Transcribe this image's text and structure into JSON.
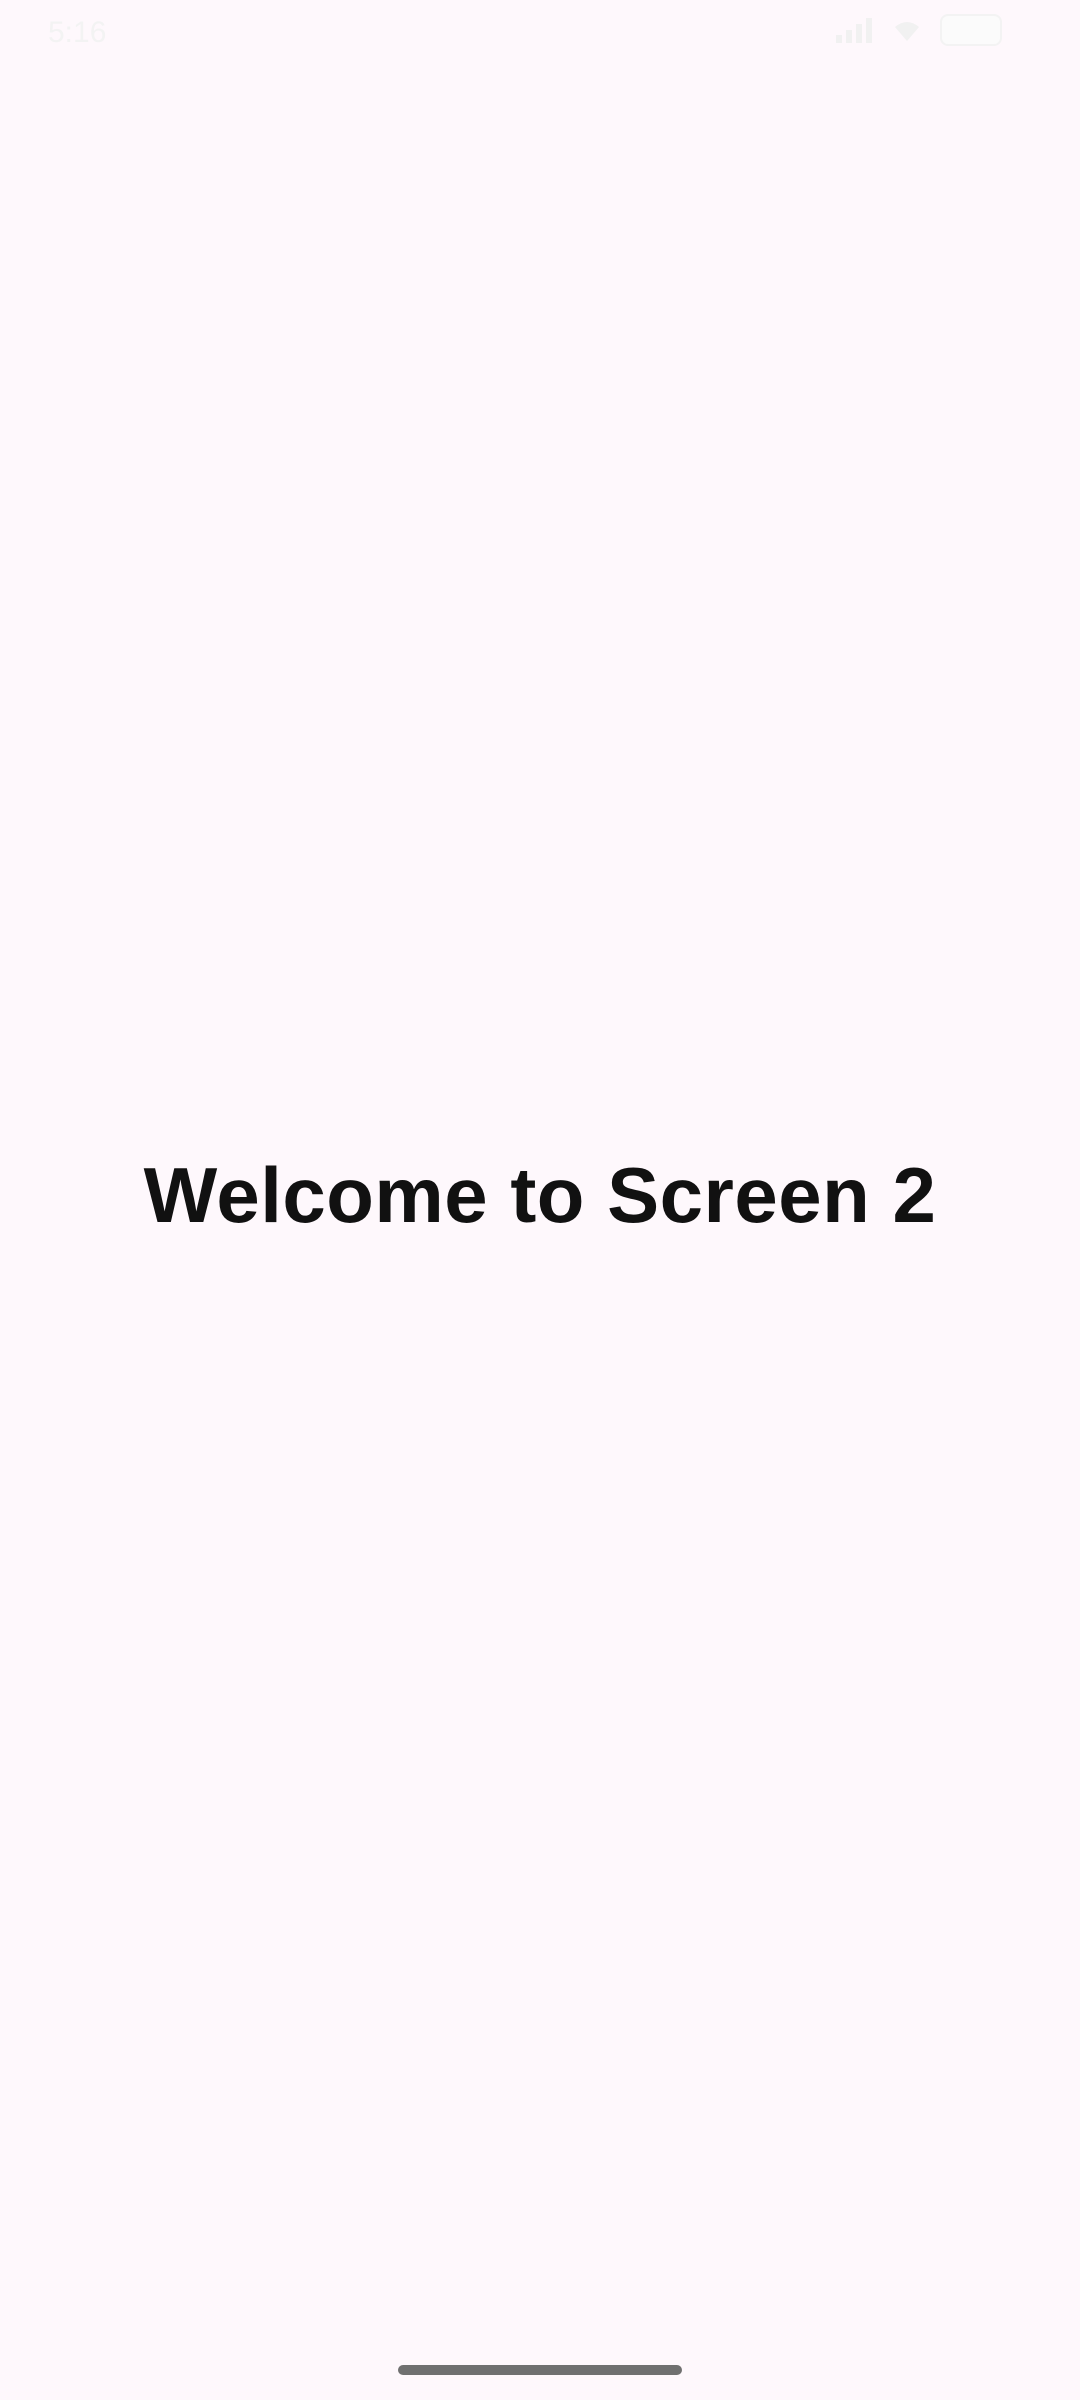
{
  "status_bar": {
    "time": "5:16",
    "icons": [
      "signal-icon",
      "wifi-icon",
      "battery-icon"
    ]
  },
  "main": {
    "heading": "Welcome to Screen 2"
  },
  "navigation": {
    "gesture_handle": "home-gesture-handle"
  },
  "colors": {
    "background": "#fef8fc",
    "text": "#111111",
    "handle": "#707070"
  }
}
